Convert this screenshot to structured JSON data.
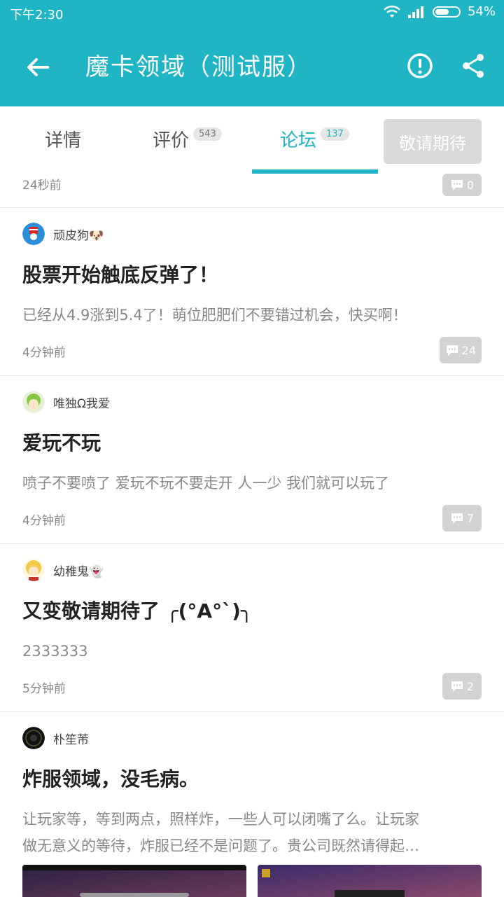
{
  "status_bar": {
    "time": "下午2:30",
    "battery": "54%",
    "battery_level": 0.54
  },
  "app_bar": {
    "title": "魔卡领域（测试服）",
    "back_icon": "back-arrow-icon",
    "report_icon": "exclamation-circle-icon",
    "share_icon": "share-icon"
  },
  "tabs": [
    {
      "label": "详情"
    },
    {
      "label": "评价",
      "count": "543"
    },
    {
      "label": "论坛",
      "count": "137",
      "active": true
    }
  ],
  "action_button": "敬请期待",
  "partial_post": {
    "time": "24秒前",
    "comments": "0"
  },
  "posts": [
    {
      "author": "顽皮狗🐶",
      "title": "股票开始触底反弹了！",
      "body": "已经从4.9涨到5.4了！萌位肥肥们不要错过机会，快买啊！",
      "time": "4分钟前",
      "comments": "24"
    },
    {
      "author": "唯独Ω我爱",
      "title": "爱玩不玩",
      "body": "喷子不要喷了   爱玩不玩不要走开   人一少   我们就可以玩了",
      "time": "4分钟前",
      "comments": "7"
    },
    {
      "author": "幼稚鬼👻",
      "title": "又变敬请期待了 ╭(°A°`)╮",
      "body": "2333333",
      "time": "5分钟前",
      "comments": "2"
    },
    {
      "author": "朴笙芾",
      "title": "炸服领域，没毛病。",
      "body_line1": "让玩家等，等到两点，照样炸，一些人可以闭嘴了么。让玩家",
      "body_line2": "做无意义的等待，炸服已经不是问题了。贵公司既然请得起…"
    }
  ]
}
